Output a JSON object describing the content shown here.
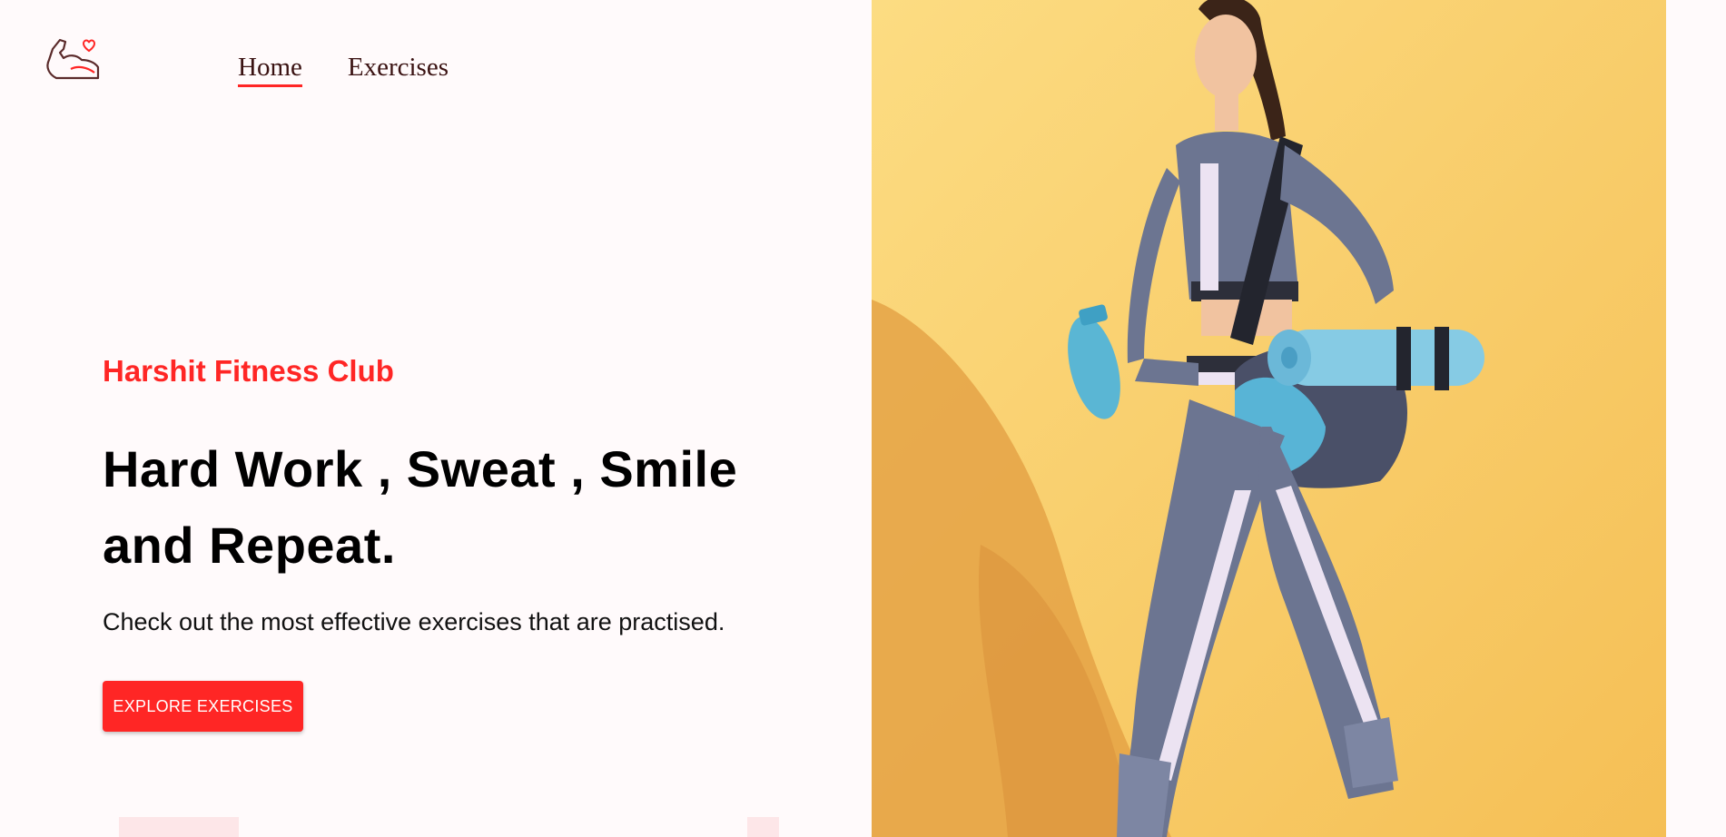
{
  "header": {
    "logo_icon": "flexed-arm-heart-icon",
    "nav": [
      {
        "label": "Home",
        "active": true
      },
      {
        "label": "Exercises",
        "active": false
      }
    ]
  },
  "hero": {
    "brand": "Harshit Fitness Club",
    "headline_line1": "Hard Work , Sweat , Smile",
    "headline_line2": "and Repeat.",
    "subtext": "Check out the most effective exercises that are practised.",
    "cta_label": "EXPLORE EXERCISES"
  },
  "colors": {
    "accent": "#ff2625",
    "background": "#fffafb",
    "photo_background": "#fbd571"
  }
}
